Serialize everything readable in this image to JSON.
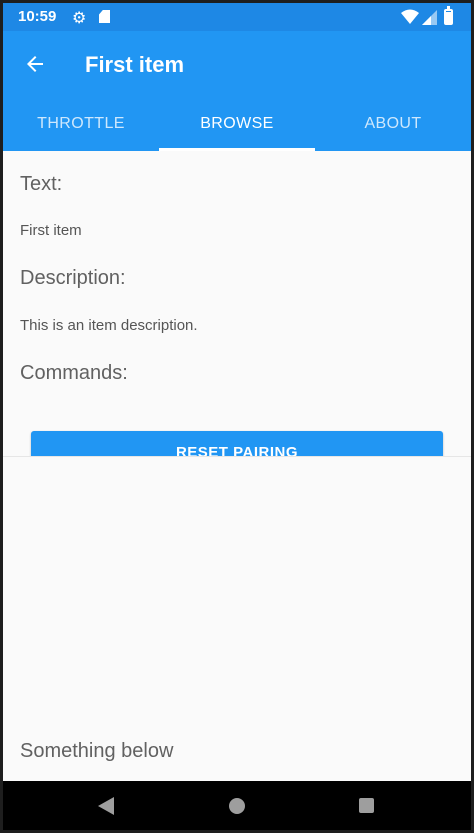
{
  "status_bar": {
    "time": "10:59",
    "battery_level": 0.9,
    "icons": [
      "gear-icon",
      "sd-card-icon",
      "wifi-icon",
      "signal-icon",
      "battery-icon"
    ]
  },
  "app_bar": {
    "title": "First item",
    "back_icon": "arrow-left-icon"
  },
  "tabs": [
    {
      "label": "THROTTLE",
      "active": false
    },
    {
      "label": "BROWSE",
      "active": true
    },
    {
      "label": "ABOUT",
      "active": false
    }
  ],
  "detail": {
    "text_label": "Text:",
    "text_value": "First item",
    "description_label": "Description:",
    "description_value": "This is an item description.",
    "commands_label": "Commands:",
    "reset_button_label": "RESET PAIRING",
    "below_text": "Something below"
  },
  "nav_bar": {
    "icons": [
      "back-triangle-icon",
      "home-circle-icon",
      "recents-square-icon"
    ]
  },
  "colors": {
    "primary": "#2196f3",
    "status_bar": "#1e88e5",
    "background": "#fafafa",
    "nav_bar": "#000000"
  }
}
